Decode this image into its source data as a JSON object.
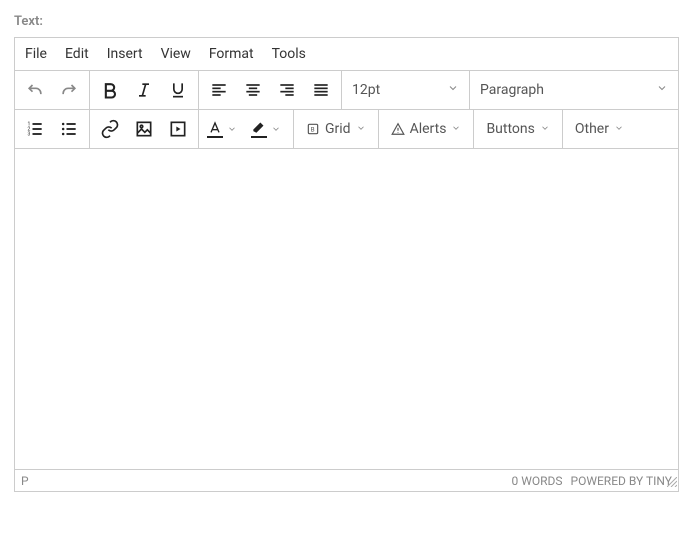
{
  "label": "Text:",
  "menubar": {
    "file": "File",
    "edit": "Edit",
    "insert": "Insert",
    "view": "View",
    "format": "Format",
    "tools": "Tools"
  },
  "toolbar": {
    "font_size": "12pt",
    "block_format": "Paragraph",
    "grid": "Grid",
    "alerts": "Alerts",
    "buttons": "Buttons",
    "other": "Other"
  },
  "status": {
    "path": "P",
    "wordcount": "0 WORDS",
    "branding": "POWERED BY TINY"
  }
}
